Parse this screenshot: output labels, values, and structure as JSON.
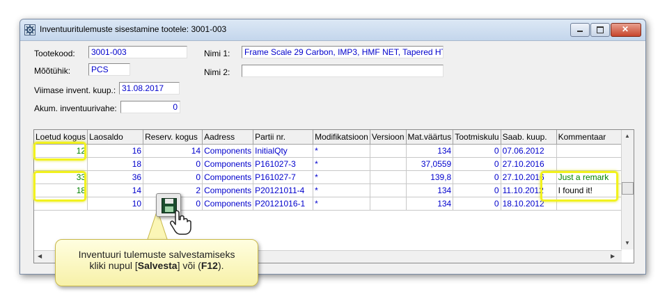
{
  "window": {
    "title": "Inventuuritulemuste sisestamine tootele: 3001-003"
  },
  "form": {
    "product_code_label": "Tootekood:",
    "product_code": "3001-003",
    "unit_label": "Mõõtühik:",
    "unit": "PCS",
    "last_inventory_label": "Viimase invent. kuup.:",
    "last_inventory_date": "31.08.2017",
    "cumulative_diff_label": "Akum. inventuurivahe:",
    "cumulative_diff": "0",
    "name1_label": "Nimi 1:",
    "name1": "Frame Scale 29 Carbon, IMP3, HMF NET, Tapered HT",
    "name2_label": "Nimi 2:",
    "name2": ""
  },
  "table": {
    "columns": [
      "Loetud kogus",
      "Laosaldo",
      "Reserv. kogus",
      "Aadress",
      "Partii nr.",
      "Modifikatsioon",
      "Versioon",
      "Mat.väärtus",
      "Tootmiskulu",
      "Saab. kuup.",
      "Kommentaar"
    ],
    "rows": [
      [
        "12",
        "16",
        "14",
        "Components",
        "InitialQty",
        "*",
        "",
        "134",
        "0",
        "07.06.2012",
        ""
      ],
      [
        "",
        "18",
        "0",
        "Components",
        "P161027-3",
        "*",
        "",
        "37,0559",
        "0",
        "27.10.2016",
        ""
      ],
      [
        "33",
        "36",
        "0",
        "Components",
        "P161027-7",
        "*",
        "",
        "139,8",
        "0",
        "27.10.2016",
        "Just a remark"
      ],
      [
        "18",
        "14",
        "2",
        "Components",
        "P20121011-4",
        "*",
        "",
        "134",
        "0",
        "11.10.2012",
        "I found it!"
      ],
      [
        "",
        "10",
        "0",
        "Components",
        "P20121016-1",
        "*",
        "",
        "134",
        "0",
        "18.10.2012",
        ""
      ]
    ]
  },
  "callout": {
    "line1": "Inventuuri tulemuste salvestamiseks",
    "line2_prefix": "kliki nupul [",
    "line2_button": "Salvesta",
    "line2_mid": "] või (",
    "line2_key": "F12",
    "line2_suffix": ")."
  },
  "icons": {
    "app": "settings-gear-icon",
    "save": "floppy-disk-icon",
    "cursor": "hand-pointer-icon"
  },
  "colors": {
    "value_text": "#0000cc",
    "highlight": "#f2f21e",
    "comment_text": "#008000",
    "callout_bg": "#fffbc4"
  }
}
